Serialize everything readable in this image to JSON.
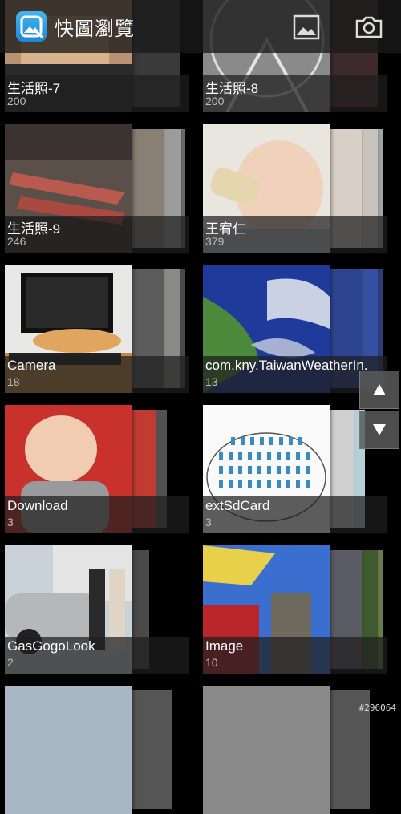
{
  "header": {
    "title": "快圖瀏覽",
    "icons": [
      "app-logo-icon",
      "gallery-icon",
      "camera-icon"
    ]
  },
  "albums": [
    {
      "name": "生活照-7",
      "count": "200"
    },
    {
      "name": "生活照-8",
      "count": "200"
    },
    {
      "name": "生活照-9",
      "count": "246"
    },
    {
      "name": "王宥仁",
      "count": "379"
    },
    {
      "name": "Camera",
      "count": "18"
    },
    {
      "name": "com.kny.TaiwanWeatherIn.",
      "count": "13"
    },
    {
      "name": "Download",
      "count": "3"
    },
    {
      "name": "extSdCard",
      "count": "3"
    },
    {
      "name": "GasGogoLook",
      "count": "2"
    },
    {
      "name": "Image",
      "count": "10"
    }
  ],
  "watermark": "#296064",
  "colors": {
    "accent": "#2a9ae6",
    "background": "#000000"
  }
}
